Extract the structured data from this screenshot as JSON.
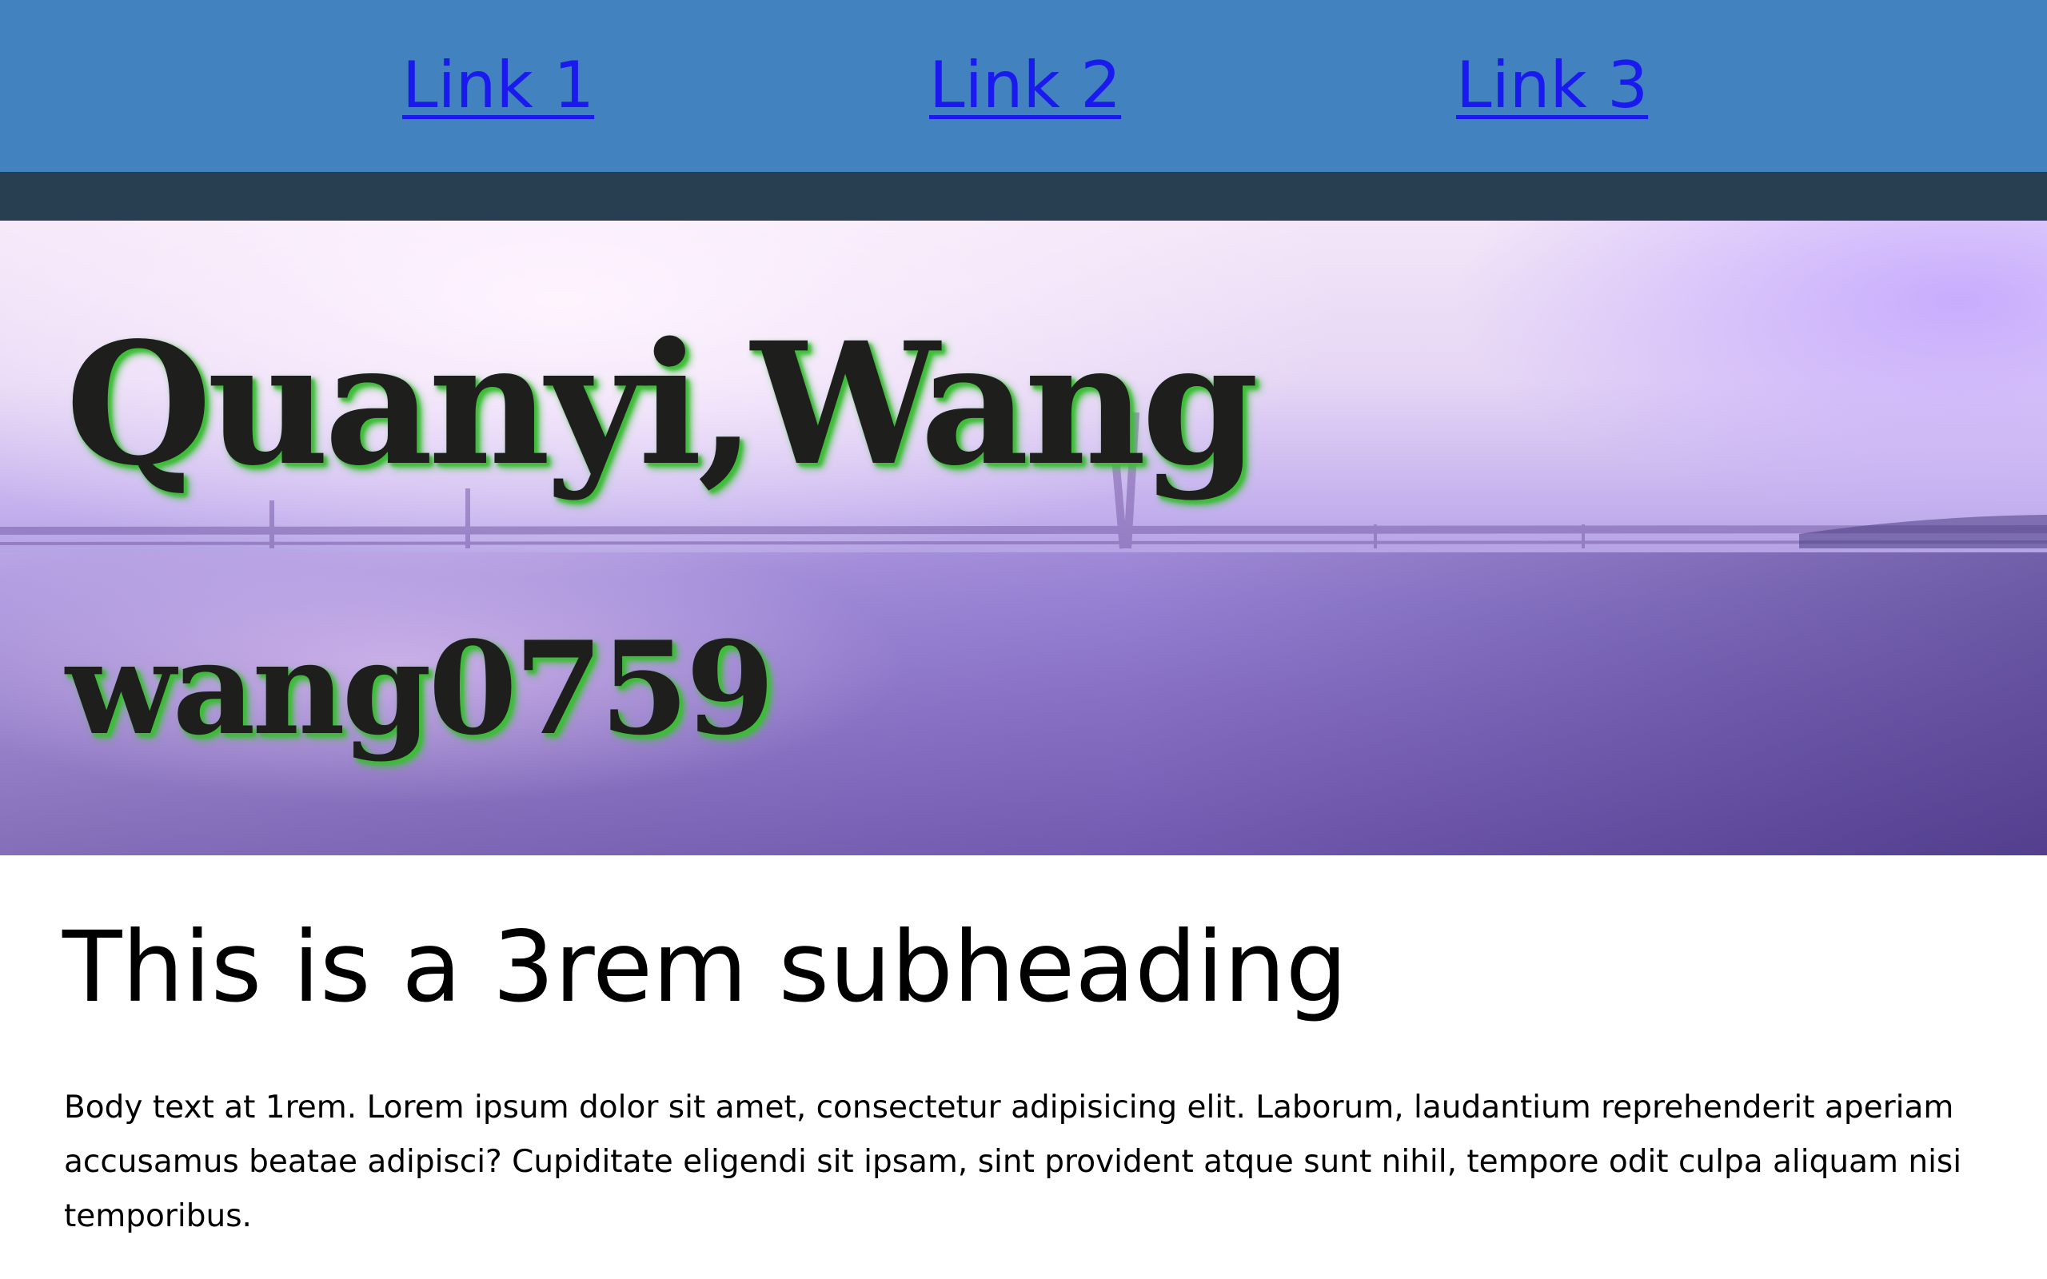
{
  "nav": {
    "links": [
      {
        "label": "Link 1"
      },
      {
        "label": "Link 2"
      },
      {
        "label": "Link 3"
      }
    ]
  },
  "hero": {
    "title": "Quanyi,Wang",
    "subtitle": "wang0759"
  },
  "content": {
    "subheading": "This is a 3rem subheading",
    "body": "Body text at 1rem. Lorem ipsum dolor sit amet, consectetur adipisicing elit. Laborum, laudantium reprehenderit aperiam accusamus beatae adipisci? Cupiditate eligendi sit ipsam, sint provident atque sunt nihil, tempore odit culpa aliquam nisi temporibus."
  },
  "colors": {
    "nav_background": "#4282bf",
    "nav_band": "#273f50",
    "link": "#1a1aee",
    "hero_text": "#1e1f1c",
    "hero_text_glow": "#3fbf3a"
  }
}
